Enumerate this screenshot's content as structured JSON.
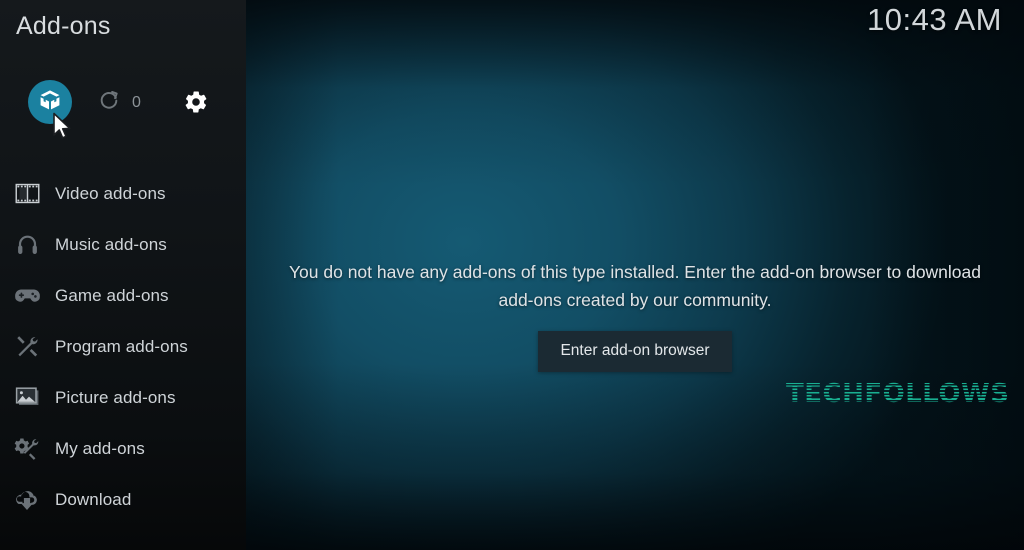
{
  "sidebar": {
    "title": "Add-ons",
    "toolbar": {
      "addon_browser": {
        "label": "Add-on browser",
        "icon": "open-box-icon",
        "accent": "#1b81a0"
      },
      "refresh": {
        "label": "Check for updates",
        "icon": "refresh-icon",
        "count": "0"
      },
      "settings": {
        "label": "Settings",
        "icon": "gear-icon"
      }
    },
    "items": [
      {
        "label": "Video add-ons",
        "icon": "film-strip-icon"
      },
      {
        "label": "Music add-ons",
        "icon": "headphones-icon"
      },
      {
        "label": "Game add-ons",
        "icon": "gamepad-icon"
      },
      {
        "label": "Program add-ons",
        "icon": "wrench-screwdriver-icon"
      },
      {
        "label": "Picture add-ons",
        "icon": "photo-icon"
      },
      {
        "label": "My add-ons",
        "icon": "gear-wrench-icon"
      },
      {
        "label": "Download",
        "icon": "cloud-download-icon"
      }
    ]
  },
  "main": {
    "clock": "10:43 AM",
    "empty_message": "You do not have any add-ons of this type installed. Enter the add-on browser to download add-ons created by our community.",
    "browser_button": "Enter add-on browser",
    "watermark": "TECHFOLLOWS"
  },
  "colors": {
    "accent": "#1b81a0",
    "background": "#124e65",
    "sidebar": "#101417",
    "button": "#1b2a33",
    "watermark": "#16a085"
  }
}
